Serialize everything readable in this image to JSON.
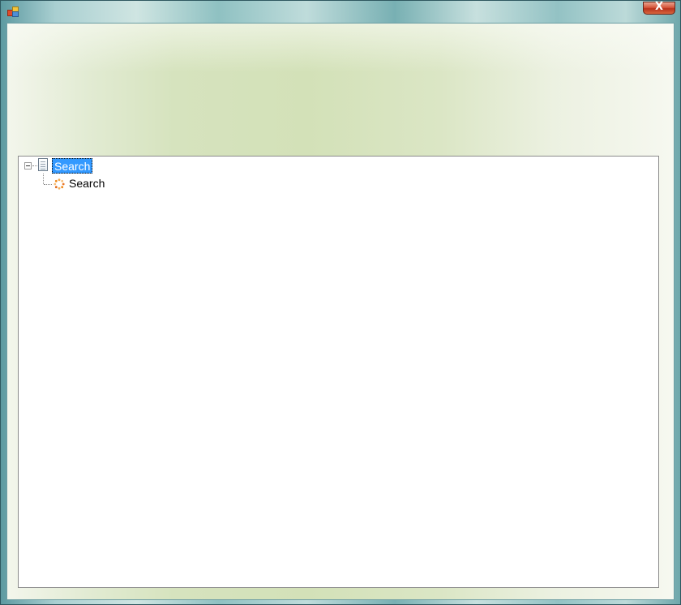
{
  "window": {
    "title": "",
    "close_label": "X"
  },
  "tree": {
    "root": {
      "label": "Search",
      "expanded": true,
      "selected": true,
      "icon": "document-icon"
    },
    "children": [
      {
        "label": "Search",
        "icon": "loading-spinner-icon"
      }
    ]
  },
  "colors": {
    "selection": "#3399ff",
    "close_button": "#c8462a",
    "client_gradient_center": "#d3e1b8",
    "spinner": "#f08a1c"
  }
}
